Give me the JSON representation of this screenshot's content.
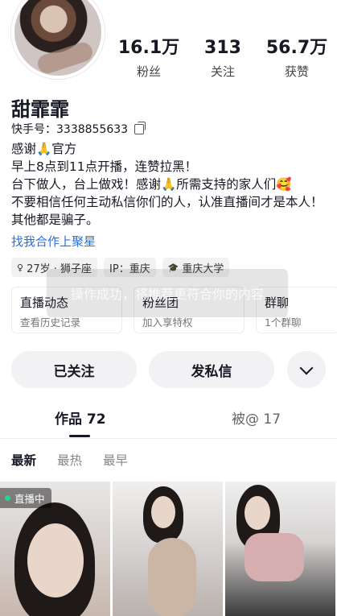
{
  "profile": {
    "name": "甜霏霏",
    "id_text": "快手号：3338855633"
  },
  "stats": [
    {
      "value": "16.1万",
      "label": "粉丝"
    },
    {
      "value": "313",
      "label": "关注"
    },
    {
      "value": "56.7万",
      "label": "获赞"
    }
  ],
  "bio": [
    "感谢🙏官方",
    "早上8点到11点开播，连赞拉黑！",
    "台下做人，台上做戏！感谢🙏所需支持的家人们🥰",
    "不要相信任何主动私信你们的人，认准直播间才是本人！其他都是骗子。"
  ],
  "link": "找我合作上聚星",
  "tags": [
    {
      "icon": "♀",
      "label": "27岁 · 狮子座"
    },
    {
      "icon": "",
      "label": "IP：重庆"
    },
    {
      "icon": "🎓",
      "label": "重庆大学"
    }
  ],
  "cards": [
    {
      "title": "直播动态",
      "sub": "查看历史记录"
    },
    {
      "title": "粉丝团",
      "sub": "加入享特权"
    },
    {
      "title": "群聊",
      "sub": "1个群聊"
    }
  ],
  "toast": "操作成功，将推荐更符合你的内容",
  "actions": {
    "follow": "已关注",
    "message": "发私信"
  },
  "tabs": {
    "works": "作品 72",
    "at": "被@ 17"
  },
  "sorts": [
    "最新",
    "最热",
    "最早"
  ],
  "live_badge": "直播中",
  "icons": {
    "copy": "copy-icon",
    "more": "chevron-down-icon",
    "gender": "female-icon",
    "school": "graduation-cap-icon",
    "live": "live-dot-icon"
  }
}
